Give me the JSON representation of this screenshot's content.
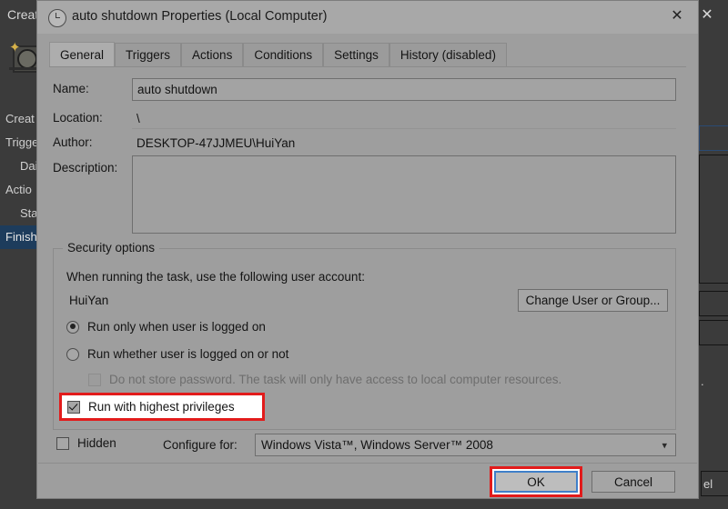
{
  "background_window": {
    "title_fragment": "Creat",
    "close_icon": "close-icon",
    "sidebar_items": [
      {
        "label": "Creat",
        "indent": false,
        "selected": false
      },
      {
        "label": "Trigge",
        "indent": false,
        "selected": false
      },
      {
        "label": "Dai",
        "indent": true,
        "selected": false
      },
      {
        "label": "Actio",
        "indent": false,
        "selected": false
      },
      {
        "label": "Sta",
        "indent": true,
        "selected": false
      },
      {
        "label": "Finish",
        "indent": false,
        "selected": true
      }
    ],
    "cancel_fragment": "el"
  },
  "dialog": {
    "title": "auto shutdown Properties (Local Computer)",
    "title_icon": "clock-icon",
    "close_icon": "close-icon",
    "tabs": [
      {
        "label": "General",
        "active": true
      },
      {
        "label": "Triggers",
        "active": false
      },
      {
        "label": "Actions",
        "active": false
      },
      {
        "label": "Conditions",
        "active": false
      },
      {
        "label": "Settings",
        "active": false
      },
      {
        "label": "History (disabled)",
        "active": false
      }
    ],
    "fields": {
      "name_label": "Name:",
      "name_value": "auto shutdown",
      "location_label": "Location:",
      "location_value": "\\",
      "author_label": "Author:",
      "author_value": "DESKTOP-47JJMEU\\HuiYan",
      "description_label": "Description:",
      "description_value": ""
    },
    "security": {
      "legend": "Security options",
      "account_prompt": "When running the task, use the following user account:",
      "account_value": "HuiYan",
      "change_user_button": "Change User or Group...",
      "radio_logged_on": "Run only when user is logged on",
      "radio_whether_logged_on": "Run whether user is logged on or not",
      "radio_selected": "logged_on",
      "do_not_store_password": "Do not store password.  The task will only have access to local computer resources.",
      "do_not_store_password_checked": false,
      "do_not_store_password_disabled": true,
      "run_highest_privileges": "Run with highest privileges",
      "run_highest_privileges_checked": true
    },
    "footer": {
      "hidden_label": "Hidden",
      "hidden_checked": false,
      "configure_for_label": "Configure for:",
      "configure_for_value": "Windows Vista™, Windows Server™ 2008",
      "chevron_icon": "chevron-down-icon",
      "ok_button": "OK",
      "cancel_button": "Cancel"
    }
  },
  "annotations": {
    "accent_color": "#e21b1b",
    "focus_color": "#3f7fc9",
    "highlighted_items": [
      "run-with-highest-privileges-checkbox",
      "ok-button"
    ]
  }
}
